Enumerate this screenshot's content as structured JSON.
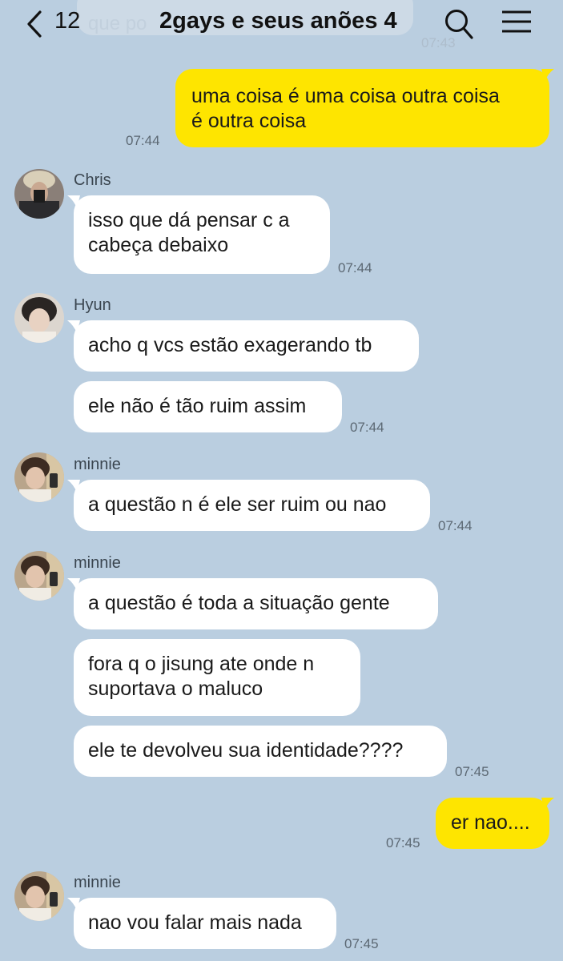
{
  "header": {
    "back_count": "12",
    "title": "2gays e seus anões 4",
    "ghost_text": "que po",
    "ghost_time": "07:43"
  },
  "messages": [
    {
      "id": "m1",
      "sender": "me",
      "lines": [
        "uma coisa é uma coisa outra coisa",
        "é outra coisa"
      ],
      "time": "07:44"
    },
    {
      "id": "m2",
      "sender": "Chris",
      "lines": [
        "isso que dá pensar c a",
        "cabeça debaixo"
      ],
      "time": "07:44"
    },
    {
      "id": "m3",
      "sender": "Hyun",
      "lines": [
        "acho q vcs estão exagerando tb"
      ],
      "time": ""
    },
    {
      "id": "m4",
      "sender": "Hyun",
      "lines": [
        "ele não é tão ruim assim"
      ],
      "time": "07:44"
    },
    {
      "id": "m5",
      "sender": "minnie",
      "lines": [
        "a questão n é ele ser ruim ou nao"
      ],
      "time": "07:44"
    },
    {
      "id": "m6",
      "sender": "minnie",
      "lines": [
        "a questão é toda a situação gente"
      ],
      "time": ""
    },
    {
      "id": "m7",
      "sender": "minnie",
      "lines": [
        "fora q o jisung ate onde n",
        "suportava o maluco"
      ],
      "time": ""
    },
    {
      "id": "m8",
      "sender": "minnie",
      "lines": [
        "ele te devolveu sua identidade????"
      ],
      "time": "07:45"
    },
    {
      "id": "m9",
      "sender": "me",
      "lines": [
        "er nao...."
      ],
      "time": "07:45"
    },
    {
      "id": "m10",
      "sender": "minnie",
      "lines": [
        "nao vou falar mais nada"
      ],
      "time": "07:45"
    }
  ],
  "senders": {
    "chris": "Chris",
    "hyun": "Hyun",
    "minnie1": "minnie",
    "minnie2": "minnie",
    "minnie3": "minnie"
  },
  "colors": {
    "background": "#bacee0",
    "my_bubble": "#fee500",
    "their_bubble": "#ffffff"
  },
  "icons": [
    "back-chevron-icon",
    "search-icon",
    "menu-icon"
  ]
}
